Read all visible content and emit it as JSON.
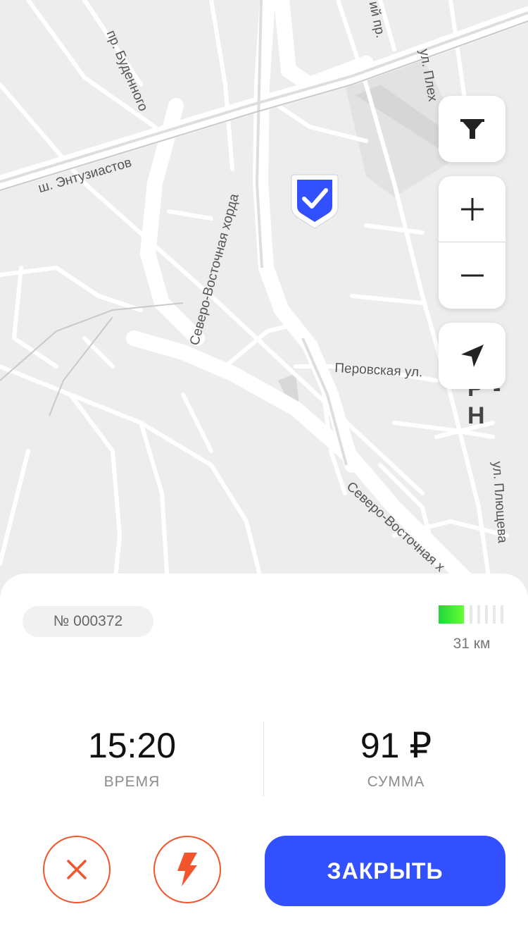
{
  "map": {
    "streets": {
      "entuziastov": "ш. Энтузиастов",
      "budennogo": "пр. Буденного",
      "sv_horda_1": "Северо-Восточная хорда",
      "sv_horda_2": "Северо-Восточная х",
      "perovskaya": "Перовская ул.",
      "plyushcheva": "ул. Плющева",
      "pleh": "ул. Плех",
      "top_pr": "ий пр."
    },
    "district_label": "Р - Н",
    "controls": {
      "filter_icon": "filter-icon",
      "zoom_in_icon": "plus-icon",
      "zoom_out_icon": "minus-icon",
      "locate_icon": "navigation-arrow-icon"
    },
    "pin_icon": "shield-check-icon"
  },
  "ride": {
    "order_number": "№ 000372",
    "battery_level": 0.38,
    "range": "31 км",
    "time_value": "15:20",
    "time_label": "ВРЕМЯ",
    "sum_value": "91 ₽",
    "sum_label": "СУММА",
    "cancel_icon": "close-icon",
    "boost_icon": "lightning-icon",
    "close_label": "ЗАКРЫТЬ"
  },
  "colors": {
    "accent": "#3350ff",
    "danger": "#f2552c",
    "battery": "#33e633"
  }
}
